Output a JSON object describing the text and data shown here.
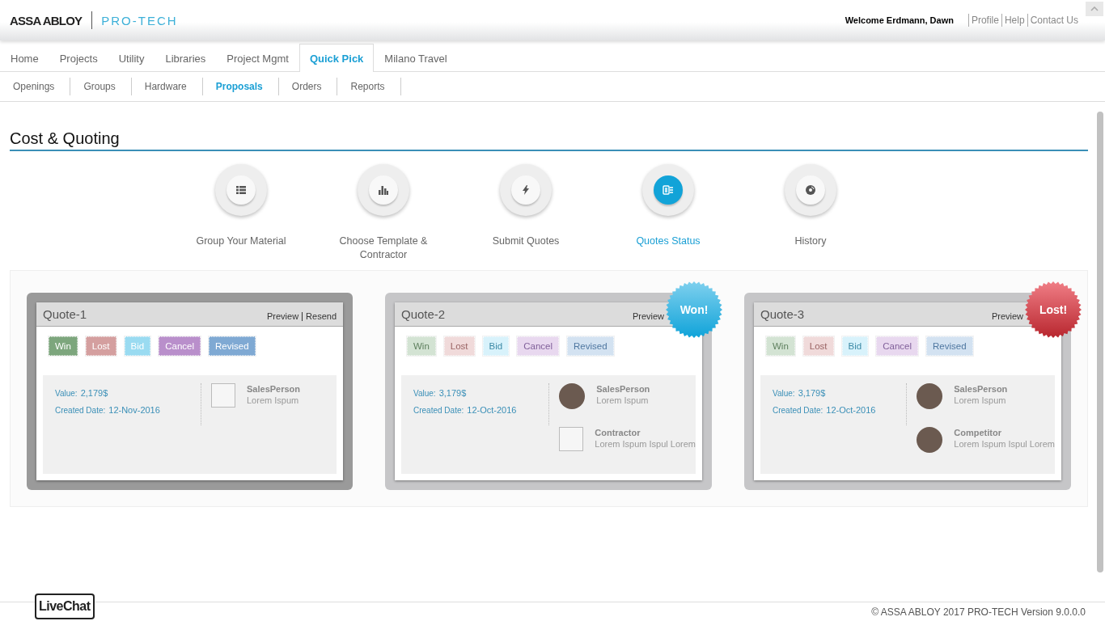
{
  "header": {
    "brand": "ASSA ABLOY",
    "product": "PRO-TECH",
    "welcome": "Welcome Erdmann, Dawn",
    "links": [
      "Profile",
      "Help",
      "Contact Us"
    ]
  },
  "tabs": [
    {
      "label": "Home",
      "selected": false
    },
    {
      "label": "Projects",
      "selected": false
    },
    {
      "label": "Utility",
      "selected": false
    },
    {
      "label": "Libraries",
      "selected": false
    },
    {
      "label": "Project Mgmt",
      "selected": false
    },
    {
      "label": "Quick Pick",
      "selected": true
    },
    {
      "label": "Milano Travel",
      "selected": false
    }
  ],
  "subtabs": [
    {
      "label": "Openings",
      "selected": false
    },
    {
      "label": "Groups",
      "selected": false
    },
    {
      "label": "Hardware",
      "selected": false
    },
    {
      "label": "Proposals",
      "selected": true
    },
    {
      "label": "Orders",
      "selected": false
    },
    {
      "label": "Reports",
      "selected": false
    }
  ],
  "page_title": "Cost & Quoting",
  "steps": [
    {
      "label": "Group Your Material",
      "kind": "list",
      "selected": false
    },
    {
      "label": "Choose Template & Contractor",
      "kind": "chart",
      "selected": false
    },
    {
      "label": "Submit Quotes",
      "kind": "bolt",
      "selected": false
    },
    {
      "label": "Quotes Status",
      "kind": "status",
      "selected": true
    },
    {
      "label": "History",
      "kind": "disc",
      "selected": false
    }
  ],
  "quotes": [
    {
      "title": "Quote-1",
      "active": true,
      "actions": [
        "Preview",
        "Resend"
      ],
      "statuses": [
        {
          "label": "Win",
          "kind": "win"
        },
        {
          "label": "Lost",
          "kind": "lost"
        },
        {
          "label": "Bid",
          "kind": "bid"
        },
        {
          "label": "Cancel",
          "kind": "cancel"
        },
        {
          "label": "Revised",
          "kind": "revised"
        }
      ],
      "value_label": "Value:",
      "value": "2,179$",
      "date_label": "Created Date:",
      "date": "12-Nov-2016",
      "people": [
        {
          "role": "SalesPerson",
          "name": "Lorem Ispum",
          "kind": "broken"
        }
      ]
    },
    {
      "title": "Quote-2",
      "active": false,
      "actions": [
        "Preview"
      ],
      "badge": {
        "kind": "won",
        "label": "Won!"
      },
      "statuses": [
        {
          "label": "Win",
          "kind": "win"
        },
        {
          "label": "Lost",
          "kind": "lost"
        },
        {
          "label": "Bid",
          "kind": "bid"
        },
        {
          "label": "Cancel",
          "kind": "cancel"
        },
        {
          "label": "Revised",
          "kind": "revised"
        }
      ],
      "value_label": "Value:",
      "value": "3,179$",
      "date_label": "Created Date:",
      "date": "12-Oct-2016",
      "people": [
        {
          "role": "SalesPerson",
          "name": "Lorem Ispum",
          "kind": "photo"
        },
        {
          "role": "Contractor",
          "name": "Lorem Ispum Ispul Lorem",
          "kind": "broken"
        }
      ]
    },
    {
      "title": "Quote-3",
      "active": false,
      "actions": [
        "Preview"
      ],
      "badge": {
        "kind": "lost",
        "label": "Lost!"
      },
      "statuses": [
        {
          "label": "Win",
          "kind": "win"
        },
        {
          "label": "Lost",
          "kind": "lost"
        },
        {
          "label": "Bid",
          "kind": "bid"
        },
        {
          "label": "Cancel",
          "kind": "cancel"
        },
        {
          "label": "Revised",
          "kind": "revised"
        }
      ],
      "value_label": "Value:",
      "value": "3,179$",
      "date_label": "Created Date:",
      "date": "12-Oct-2016",
      "people": [
        {
          "role": "SalesPerson",
          "name": "Lorem Ispum",
          "kind": "photo"
        },
        {
          "role": "Competitor",
          "name": "Lorem Ispum Ispul Lorem",
          "kind": "photo"
        }
      ]
    }
  ],
  "livechat": "LiveChat",
  "footer": "© ASSA ABLOY 2017 PRO-TECH Version 9.0.0.0"
}
